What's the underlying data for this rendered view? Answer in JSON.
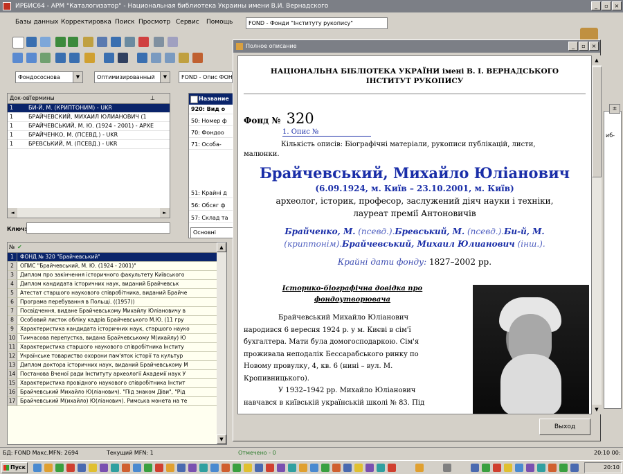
{
  "app": {
    "title": "ИРБИС64 - АРМ \"Каталогизатор\" - Национальная библиотека Украины имени В.И. Вернадского",
    "menu": [
      "Базы данных",
      "Корректировка",
      "Поиск",
      "Просмотр",
      "Сервис",
      "Помощь"
    ],
    "db_combo": "FOND - Фонди \"Інституту рукопису\"",
    "toolbar2_combos": [
      "Фондососнова",
      "Оптимизированный",
      "FOND - Опис ФОН"
    ]
  },
  "dictionary": {
    "headers": [
      "Док-ов",
      "Термины"
    ],
    "rows": [
      {
        "count": "1",
        "term": "БИ-Й, М. (КРИПТОНИМ) - UKR"
      },
      {
        "count": "1",
        "term": "БРАЙЧЕВСКИЙ, МИХАИЛ ЮЛИАНОВИЧ (1"
      },
      {
        "count": "1",
        "term": "БРАЙЧЕВСЬКИЙ, М. Ю. (1924 - 2001) - АРХЕ"
      },
      {
        "count": "1",
        "term": "БРАЙЧЕНКО, М. (ПСЕВД.) - UKR"
      },
      {
        "count": "1",
        "term": "БРЕВСЬКИЙ, М. (ПСЕВД.) - UKR"
      }
    ],
    "key_label": "Ключ:"
  },
  "fields": {
    "header": "Название",
    "rows": [
      "920: Вид о",
      "50: Номер ф",
      "70: Фондоо",
      "71: Особа-",
      "",
      "",
      "",
      "51: Крайні д",
      "56: Обсяг ф",
      "57: Склад та"
    ],
    "tab": "Основні відом"
  },
  "records": {
    "header": "№",
    "rows": [
      "ФОНД № 320 \"Брайчевський\"",
      "ОПИС \"Брайчевський, М. Ю. (1924 - 2001)\"",
      "Диплом про закінчення історичного факультету Київського",
      "Диплом кандидата історичних наук, виданий Брайчевськ",
      "Атестат старшого наукового співробітника, виданий Брайче",
      "Програма перебування в Польщі. ((1957))",
      "Посвідчення, видане Брайчевському Михайлу Юліановичу в",
      "Особовий листок обліку кадрів Брайчевського М.Ю. (11 гру",
      "Характеристика кандидата історичних наук, старшого науко",
      "Тимчасова перепустка, видана Брайчевському М(ихайлу) Ю",
      "Характеристика старшого наукового співробітника Інститу",
      "Українське товариство охорони пам'яток історії та культур",
      "Диплом доктора історичних наук, виданий Брайчевському М",
      "Постанова Вченої ради Інституту археології Академії наук У",
      "Характеристика провідного наукового співробітника Інстит",
      "Брайчевський Михайло Ю(ліанович). \"Під знаком Діви\", \"Рід",
      "Брайчевський М(ихайло) Ю(ліанович). Римська монета на те"
    ]
  },
  "right_panel": {
    "p_label": "П",
    "code": "иб-",
    "plus": "±"
  },
  "dialog": {
    "title": "Полное описание",
    "org_line1": "НАЦІОНАЛЬНА БІБЛІОТЕКА УКРАЇНИ імені В. І. ВЕРНАДСЬКОГО",
    "org_line2": "ІНСТИТУТ РУКОПИСУ",
    "fond_label": "Фонд №",
    "fond_number": "320",
    "opys_link": "1. Опис №",
    "opys_text_1": "Кількість описів: Біографічні матеріали, рукописи публікацій, листи,",
    "opys_text_2": "малюнки.",
    "person_name": "Брайчевський, Михайло Юліанович",
    "dates": "(6.09.1924, м. Київ – 23.10.2001, м. Київ)",
    "prof_1": "археолог, історик, професор, заслужений діяч науки і техніки,",
    "prof_2": "лауреат премії Антоновичів",
    "aliases_1": [
      {
        "t": "Брайченко, М.",
        "s": "b"
      },
      {
        "t": " (псевд.).",
        "s": "n"
      },
      {
        "t": "Бревський, М.",
        "s": "b"
      },
      {
        "t": " (псевд.).",
        "s": "n"
      },
      {
        "t": "Би-й, М.",
        "s": "b"
      }
    ],
    "aliases_2": [
      {
        "t": "(криптонім).",
        "s": "n"
      },
      {
        "t": "Брайчевський, Михаил Юлианович",
        "s": "b"
      },
      {
        "t": " (інш.).",
        "s": "n"
      }
    ],
    "dates_label": "Крайні дати фонду:",
    "dates_value": "1827–2002 рр.",
    "bio_heading_1": "Історико-біографічна довідка про",
    "bio_heading_2": "фондоутворювача",
    "bio_lines": [
      "Брайчевський      Михайло      Юліанович",
      "народився 6 вересня 1924 р. у м. Києві в сім'ї",
      "бухгалтера. Мати була домогосподаркою. Сім'я",
      "проживала неподалік Бессарабського ринку по",
      "Новому провулку, 4, кв. 6 (нині – вул. М.",
      "Кропивницького).",
      "У 1932–1942 рр. Михайло Юліанович",
      "навчався в київській українській школі № 83. Під"
    ],
    "exit_button": "Выход"
  },
  "status": {
    "db": "БД: FOND Макс.MFN: 2694",
    "mfn": "Текущий MFN: 1",
    "marked": "Отмечено - 0",
    "time": "20:10 00:"
  },
  "taskbar": {
    "start": "Пуск",
    "clock": "20:10"
  },
  "colors": {
    "selection": "#0a246a",
    "link": "#1a2ea8",
    "title_grey": "#7c7f86",
    "chrome": "#d4d0c8"
  }
}
